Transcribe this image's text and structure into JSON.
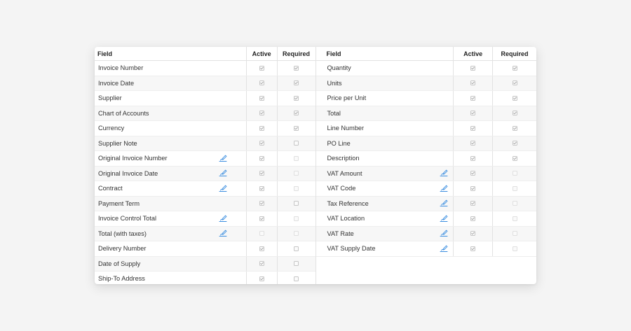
{
  "columns": {
    "field": "Field",
    "active": "Active",
    "required": "Required"
  },
  "colors": {
    "accent": "#3b8ee0",
    "check": "#9a9a9a",
    "border": "#e2e2e2"
  },
  "left": [
    {
      "label": "Invoice Number",
      "editable": false,
      "active": true,
      "active_enabled": true,
      "required": true,
      "required_enabled": true
    },
    {
      "label": "Invoice Date",
      "editable": false,
      "active": true,
      "active_enabled": true,
      "required": true,
      "required_enabled": true
    },
    {
      "label": "Supplier",
      "editable": false,
      "active": true,
      "active_enabled": true,
      "required": true,
      "required_enabled": true
    },
    {
      "label": "Chart of Accounts",
      "editable": false,
      "active": true,
      "active_enabled": true,
      "required": true,
      "required_enabled": true
    },
    {
      "label": "Currency",
      "editable": false,
      "active": true,
      "active_enabled": true,
      "required": true,
      "required_enabled": true
    },
    {
      "label": "Supplier Note",
      "editable": false,
      "active": true,
      "active_enabled": true,
      "required": false,
      "required_enabled": true
    },
    {
      "label": "Original Invoice Number",
      "editable": true,
      "active": true,
      "active_enabled": true,
      "required": false,
      "required_enabled": false
    },
    {
      "label": "Original Invoice Date",
      "editable": true,
      "active": true,
      "active_enabled": true,
      "required": false,
      "required_enabled": false
    },
    {
      "label": "Contract",
      "editable": true,
      "active": true,
      "active_enabled": true,
      "required": false,
      "required_enabled": false
    },
    {
      "label": "Payment Term",
      "editable": false,
      "active": true,
      "active_enabled": true,
      "required": false,
      "required_enabled": true
    },
    {
      "label": "Invoice Control Total",
      "editable": true,
      "active": true,
      "active_enabled": true,
      "required": false,
      "required_enabled": false
    },
    {
      "label": "Total (with taxes)",
      "editable": true,
      "active": false,
      "active_enabled": false,
      "required": false,
      "required_enabled": false
    },
    {
      "label": "Delivery Number",
      "editable": false,
      "active": true,
      "active_enabled": true,
      "required": false,
      "required_enabled": true
    },
    {
      "label": "Date of Supply",
      "editable": false,
      "active": true,
      "active_enabled": true,
      "required": false,
      "required_enabled": true
    },
    {
      "label": "Ship-To Address",
      "editable": false,
      "active": true,
      "active_enabled": true,
      "required": false,
      "required_enabled": true
    }
  ],
  "right": [
    {
      "label": "Quantity",
      "editable": false,
      "active": true,
      "active_enabled": true,
      "required": true,
      "required_enabled": true
    },
    {
      "label": "Units",
      "editable": false,
      "active": true,
      "active_enabled": true,
      "required": true,
      "required_enabled": true
    },
    {
      "label": "Price per Unit",
      "editable": false,
      "active": true,
      "active_enabled": true,
      "required": true,
      "required_enabled": true
    },
    {
      "label": "Total",
      "editable": false,
      "active": true,
      "active_enabled": true,
      "required": true,
      "required_enabled": true
    },
    {
      "label": "Line Number",
      "editable": false,
      "active": true,
      "active_enabled": true,
      "required": true,
      "required_enabled": true
    },
    {
      "label": "PO Line",
      "editable": false,
      "active": true,
      "active_enabled": true,
      "required": true,
      "required_enabled": true
    },
    {
      "label": "Description",
      "editable": false,
      "active": true,
      "active_enabled": true,
      "required": true,
      "required_enabled": true
    },
    {
      "label": "VAT Amount",
      "editable": true,
      "active": true,
      "active_enabled": true,
      "required": false,
      "required_enabled": false
    },
    {
      "label": "VAT Code",
      "editable": true,
      "active": true,
      "active_enabled": true,
      "required": false,
      "required_enabled": false
    },
    {
      "label": "Tax Reference",
      "editable": true,
      "active": true,
      "active_enabled": true,
      "required": false,
      "required_enabled": false
    },
    {
      "label": "VAT Location",
      "editable": true,
      "active": true,
      "active_enabled": true,
      "required": false,
      "required_enabled": false
    },
    {
      "label": "VAT Rate",
      "editable": true,
      "active": true,
      "active_enabled": true,
      "required": false,
      "required_enabled": false
    },
    {
      "label": "VAT Supply Date",
      "editable": true,
      "active": true,
      "active_enabled": true,
      "required": false,
      "required_enabled": false
    }
  ]
}
